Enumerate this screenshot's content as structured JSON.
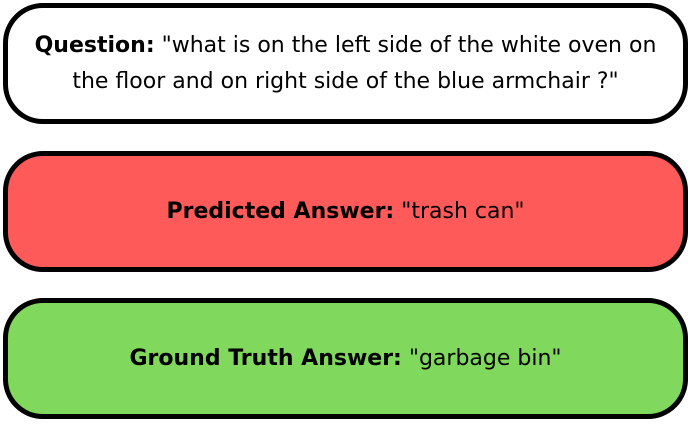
{
  "question": {
    "label": "Question:",
    "text": " \"what is on the left side of the white oven on the floor and on right side of the blue armchair ?\""
  },
  "predicted": {
    "label": "Predicted Answer:",
    "text": " \"trash can\""
  },
  "ground_truth": {
    "label": "Ground Truth Answer:",
    "text": " \"garbage bin\""
  },
  "colors": {
    "predicted_fill": "#ff5a5a",
    "ground_truth_fill": "#80d95c",
    "question_fill": "#ffffff",
    "border": "#000000"
  }
}
